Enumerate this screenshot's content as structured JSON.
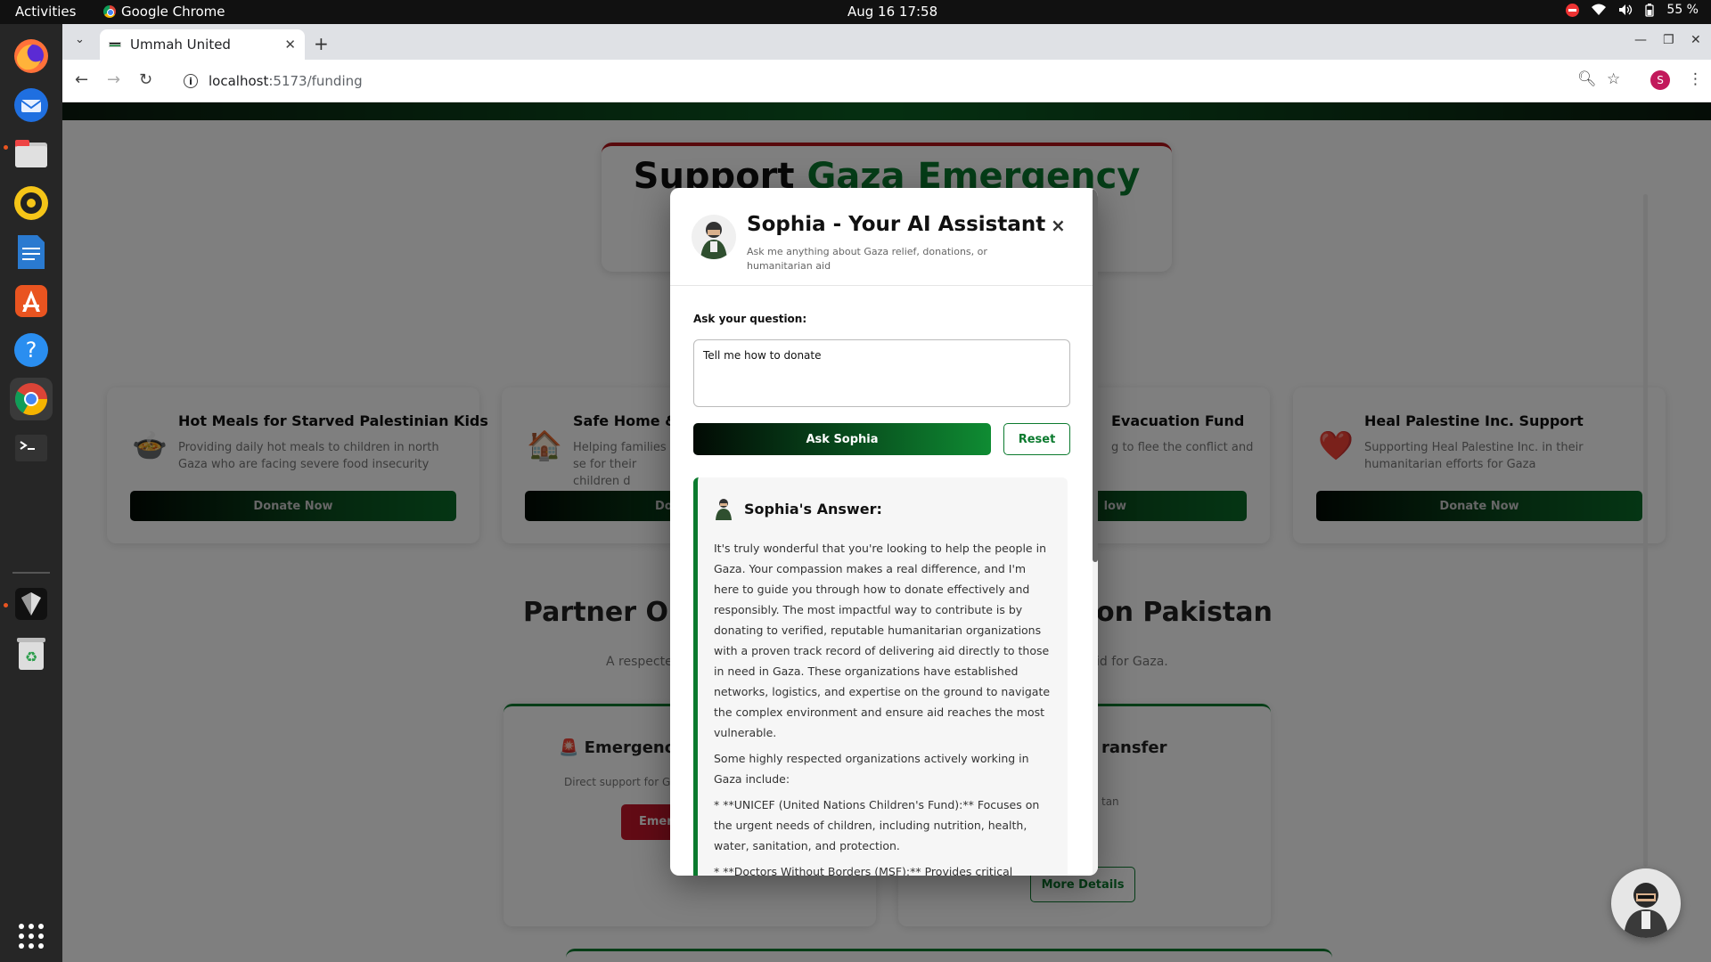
{
  "os": {
    "activities": "Activities",
    "app_name": "Google Chrome",
    "clock": "Aug 16  17:58",
    "battery": "55 %"
  },
  "browser": {
    "tab_title": "Ummah United",
    "url_host": "localhost",
    "url_path": ":5173/funding"
  },
  "page": {
    "hero_title_part1": "Support ",
    "hero_title_part2": "Gaza Emergency",
    "fund_cards": [
      {
        "icon": "🍲",
        "title": "Hot Meals for Starved Palestinian Kids",
        "desc": "Providing daily hot meals to children in north Gaza who are facing severe food insecurity",
        "button": "Donate Now"
      },
      {
        "icon": "🏠",
        "title": "Safe Home & I",
        "desc": "Helping families se for their children d",
        "button": "Do"
      },
      {
        "icon": "",
        "title": "Evacuation Fund",
        "desc": "g to flee the conflict and",
        "button": "low"
      },
      {
        "icon": "❤️",
        "title": "Heal Palestine Inc. Support",
        "desc": "Supporting Heal Palestine Inc. in their humanitarian efforts for Gaza",
        "button": "Donate Now"
      }
    ],
    "partner_title_left": "Partner Or",
    "partner_title_right": "on Pakistan",
    "partner_sub_left": "A respecte",
    "partner_sub_right": "id for Gaza.",
    "partner_cards": [
      {
        "title": "🚨 Emergency",
        "desc": "Direct support for G",
        "button": "Emer"
      },
      {
        "title": "ransfer",
        "desc": "tan",
        "button": "More Details"
      }
    ]
  },
  "modal": {
    "title": "Sophia - Your AI Assistant",
    "subtitle": "Ask me anything about Gaza relief, donations, or humanitarian aid",
    "close": "×",
    "question_label": "Ask your question:",
    "question_value": "Tell me how to donate",
    "ask_button": "Ask Sophia",
    "reset_button": "Reset",
    "answer_title": "Sophia's Answer:",
    "answer_paragraphs": [
      "It's truly wonderful that you're looking to help the people in Gaza. Your compassion makes a real difference, and I'm here to guide you through how to donate effectively and responsibly. The most impactful way to contribute is by donating to verified, reputable humanitarian organizations with a proven track record of delivering aid directly to those in need in Gaza. These organizations have established networks, logistics, and expertise on the ground to navigate the complex environment and ensure aid reaches the most vulnerable.",
      "Some highly respected organizations actively working in Gaza include:",
      "* **UNICEF (United Nations Children's Fund):** Focuses on the urgent needs of children, including nutrition, health, water, sanitation, and protection.",
      "* **Doctors Without Borders (MSF):** Provides critical medical aid, surgical care, and mental health support, often operating in"
    ]
  }
}
